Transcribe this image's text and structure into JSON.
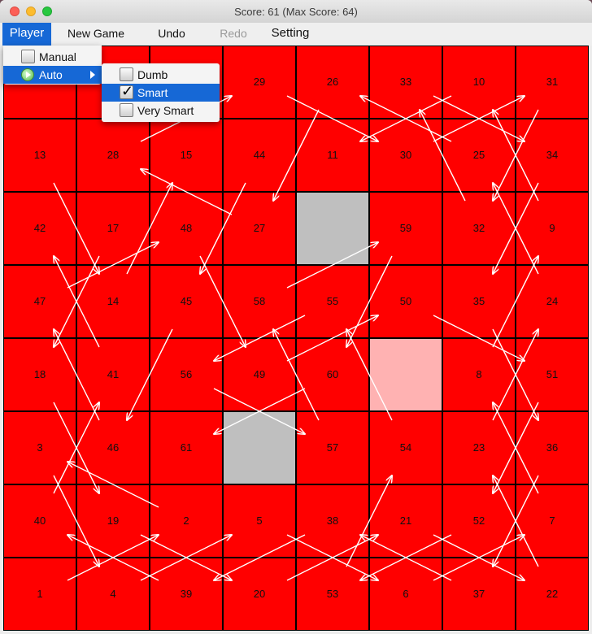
{
  "window": {
    "title": "Score: 61 (Max Score: 64)",
    "colors": {
      "cell": "#ff0000",
      "blocked": "#bfbfbf",
      "highlight": "#ffb2b2",
      "arrow": "#ffffff",
      "menu_selection": "#1668d6"
    }
  },
  "menubar": {
    "player": "Player",
    "new_game": "New Game",
    "undo": "Undo",
    "redo": "Redo",
    "setting": "Setting"
  },
  "player_menu": {
    "manual": "Manual",
    "auto": "Auto",
    "auto_icon": "play-circle-icon",
    "submenu_icon": "chevron-right-icon"
  },
  "auto_submenu": {
    "items": [
      {
        "label": "Dumb",
        "checked": false
      },
      {
        "label": "Smart",
        "checked": true
      },
      {
        "label": "Very Smart",
        "checked": false
      }
    ]
  },
  "board": {
    "rows": 8,
    "cols": 8,
    "cells": [
      [
        "",
        "",
        "",
        "29",
        "26",
        "33",
        "10",
        "31"
      ],
      [
        "13",
        "28",
        "15",
        "44",
        "11",
        "30",
        "25",
        "34"
      ],
      [
        "42",
        "17",
        "48",
        "27",
        "",
        "59",
        "32",
        "9"
      ],
      [
        "47",
        "14",
        "45",
        "58",
        "55",
        "50",
        "35",
        "24"
      ],
      [
        "18",
        "41",
        "56",
        "49",
        "60",
        "",
        "8",
        "51"
      ],
      [
        "3",
        "46",
        "61",
        "",
        "57",
        "54",
        "23",
        "36"
      ],
      [
        "40",
        "19",
        "2",
        "5",
        "38",
        "21",
        "52",
        "7"
      ],
      [
        "1",
        "4",
        "39",
        "20",
        "53",
        "6",
        "37",
        "22"
      ]
    ],
    "gray_cells": [
      [
        2,
        4
      ],
      [
        5,
        3
      ]
    ],
    "highlight_cells": [
      [
        4,
        5
      ]
    ]
  }
}
